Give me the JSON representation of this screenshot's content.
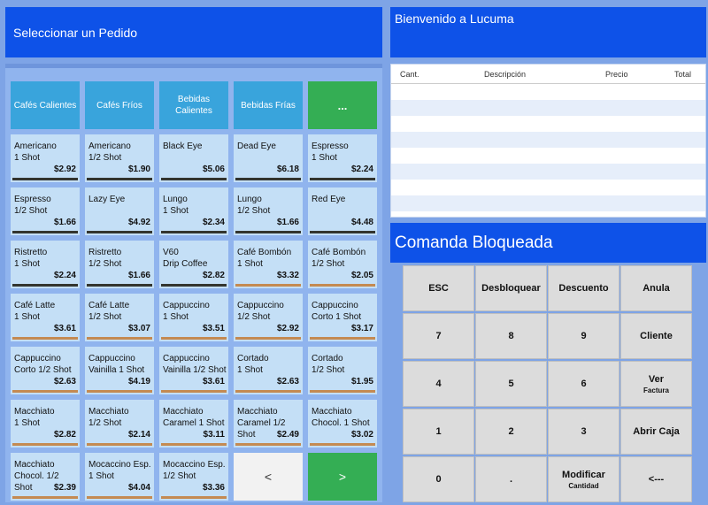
{
  "left_header": {
    "title": "Seleccionar un Pedido"
  },
  "right_header": {
    "title": "Bienvenido a Lucuma"
  },
  "categories": [
    {
      "label": "Cafés Calientes"
    },
    {
      "label": "Cafés Fríos"
    },
    {
      "label": "Bebidas Calientes"
    },
    {
      "label": "Bebidas Frías"
    },
    {
      "label": "..."
    }
  ],
  "products": [
    {
      "name": "Americano\n1 Shot",
      "price": "$2.92",
      "bar_color": "#33352f"
    },
    {
      "name": "Americano\n1/2 Shot",
      "price": "$1.90",
      "bar_color": "#33352f"
    },
    {
      "name": "Black Eye",
      "price": "$5.06",
      "bar_color": "#33352f"
    },
    {
      "name": "Dead Eye",
      "price": "$6.18",
      "bar_color": "#33352f"
    },
    {
      "name": "Espresso\n1 Shot",
      "price": "$2.24",
      "bar_color": "#33352f"
    },
    {
      "name": "Espresso\n1/2 Shot",
      "price": "$1.66",
      "bar_color": "#33352f"
    },
    {
      "name": "Lazy Eye",
      "price": "$4.92",
      "bar_color": "#33352f"
    },
    {
      "name": "Lungo\n1 Shot",
      "price": "$2.34",
      "bar_color": "#33352f"
    },
    {
      "name": "Lungo\n1/2 Shot",
      "price": "$1.66",
      "bar_color": "#33352f"
    },
    {
      "name": "Red Eye",
      "price": "$4.48",
      "bar_color": "#33352f"
    },
    {
      "name": "Ristretto\n1 Shot",
      "price": "$2.24",
      "bar_color": "#33352f"
    },
    {
      "name": "Ristretto\n1/2 Shot",
      "price": "$1.66",
      "bar_color": "#33352f"
    },
    {
      "name": "V60\nDrip Coffee",
      "price": "$2.82",
      "bar_color": "#33352f"
    },
    {
      "name": "Café Bombón\n1 Shot",
      "price": "$3.32",
      "bar_color": "#c48a52"
    },
    {
      "name": "Café Bombón\n1/2 Shot",
      "price": "$2.05",
      "bar_color": "#c48a52"
    },
    {
      "name": "Café Latte\n1 Shot",
      "price": "$3.61",
      "bar_color": "#c48a52"
    },
    {
      "name": "Café Latte\n1/2 Shot",
      "price": "$3.07",
      "bar_color": "#c48a52"
    },
    {
      "name": "Cappuccino\n1 Shot",
      "price": "$3.51",
      "bar_color": "#c48a52"
    },
    {
      "name": "Cappuccino\n1/2 Shot",
      "price": "$2.92",
      "bar_color": "#c48a52"
    },
    {
      "name": "Cappuccino\nCorto 1 Shot",
      "price": "$3.17",
      "bar_color": "#c48a52"
    },
    {
      "name": "Cappuccino\nCorto 1/2 Shot",
      "price": "$2.63",
      "bar_color": "#c48a52"
    },
    {
      "name": "Cappuccino\nVainilla 1 Shot",
      "price": "$4.19",
      "bar_color": "#c48a52"
    },
    {
      "name": "Cappuccino\nVainilla 1/2 Shot",
      "price": "$3.61",
      "bar_color": "#c48a52"
    },
    {
      "name": "Cortado\n1 Shot",
      "price": "$2.63",
      "bar_color": "#c48a52"
    },
    {
      "name": "Cortado\n1/2 Shot",
      "price": "$1.95",
      "bar_color": "#c48a52"
    },
    {
      "name": "Macchiato\n1 Shot",
      "price": "$2.82",
      "bar_color": "#c48a52"
    },
    {
      "name": "Macchiato\n1/2 Shot",
      "price": "$2.14",
      "bar_color": "#c48a52"
    },
    {
      "name": "Macchiato\nCaramel 1 Shot",
      "price": "$3.11",
      "bar_color": "#c48a52"
    },
    {
      "name": "Macchiato\nCaramel 1/2 Shot",
      "price": "$2.49",
      "bar_color": "#c48a52"
    },
    {
      "name": "Macchiato\nChocol. 1 Shot",
      "price": "$3.02",
      "bar_color": "#c48a52"
    },
    {
      "name": "Macchiato\nChocol. 1/2 Shot",
      "price": "$2.39",
      "bar_color": "#c48a52"
    },
    {
      "name": "Mocaccino Esp.\n1 Shot",
      "price": "$4.04",
      "bar_color": "#c48a52"
    },
    {
      "name": "Mocaccino Esp.\n1/2 Shot",
      "price": "$3.36",
      "bar_color": "#c48a52"
    }
  ],
  "nav": {
    "prev_label": "<",
    "next_label": ">"
  },
  "order_table": {
    "headers": {
      "qty": "Cant.",
      "desc": "Descripción",
      "price": "Precio",
      "total": "Total"
    }
  },
  "comanda": {
    "title": "Comanda Bloqueada"
  },
  "keypad": [
    {
      "label": "ESC",
      "sub": ""
    },
    {
      "label": "Desbloquear",
      "sub": ""
    },
    {
      "label": "Descuento",
      "sub": ""
    },
    {
      "label": "Anula",
      "sub": ""
    },
    {
      "label": "7",
      "sub": ""
    },
    {
      "label": "8",
      "sub": ""
    },
    {
      "label": "9",
      "sub": ""
    },
    {
      "label": "Cliente",
      "sub": ""
    },
    {
      "label": "4",
      "sub": ""
    },
    {
      "label": "5",
      "sub": ""
    },
    {
      "label": "6",
      "sub": ""
    },
    {
      "label": "Ver",
      "sub": "Factura"
    },
    {
      "label": "1",
      "sub": ""
    },
    {
      "label": "2",
      "sub": ""
    },
    {
      "label": "3",
      "sub": ""
    },
    {
      "label": "Abrir Caja",
      "sub": ""
    },
    {
      "label": "0",
      "sub": ""
    },
    {
      "label": ".",
      "sub": ""
    },
    {
      "label": "Modificar",
      "sub": "Cantidad"
    },
    {
      "label": "<---",
      "sub": ""
    }
  ]
}
